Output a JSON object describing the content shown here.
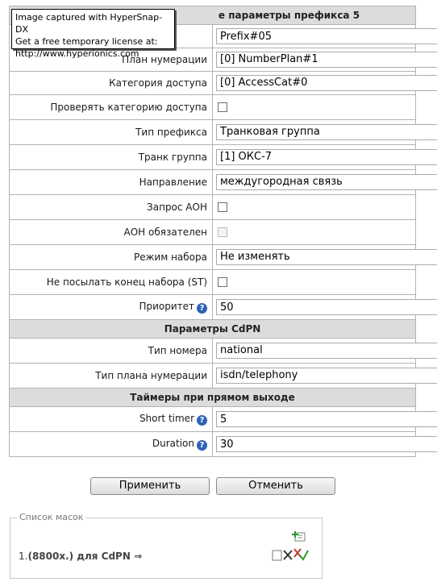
{
  "overlay": {
    "line1": "Image captured with HyperSnap-DX",
    "line2": "Get a free temporary license at:",
    "line3": "http://www.hyperionics.com"
  },
  "prefix_section": {
    "header": "е параметры префикса 5",
    "name_value": "Prefix#05",
    "fields": {
      "numplan_label": "План нумерации",
      "numplan_value": "[0] NumberPlan#1",
      "access_label": "Категория доступа",
      "access_value": "[0] AccessCat#0",
      "check_access_label": "Проверять категорию доступа",
      "prefix_type_label": "Тип префикса",
      "prefix_type_value": "Транковая группа",
      "trunk_label": "Транк группа",
      "trunk_value": "[1] ОКС-7",
      "direction_label": "Направление",
      "direction_value": "междугородная связь",
      "aon_request_label": "Запрос АОН",
      "aon_required_label": "АОН обязателен",
      "dial_mode_label": "Режим набора",
      "dial_mode_value": "Не изменять",
      "no_st_label": "Не посылать конец набора (ST)",
      "priority_label": "Приоритет",
      "priority_value": "50"
    }
  },
  "cdpn_section": {
    "header": "Параметры CdPN",
    "number_type_label": "Тип номера",
    "number_type_value": "national",
    "plan_type_label": "Тип плана нумерации",
    "plan_type_value": "isdn/telephony"
  },
  "timers_section": {
    "header": "Таймеры при прямом выходе",
    "short_timer_label": "Short timer",
    "short_timer_value": "5",
    "duration_label": "Duration",
    "duration_value": "30"
  },
  "buttons": {
    "apply": "Применить",
    "cancel": "Отменить"
  },
  "masks": {
    "legend": "Список масок",
    "items": [
      {
        "index": "1.",
        "mask": "(8800x.) для CdPN ⇒"
      }
    ]
  },
  "icons": {
    "help": "help-icon",
    "add": "add-mask-icon",
    "tools": "edit-tools-icon"
  },
  "colors": {
    "header_bg": "#dcdcdc",
    "border": "#b3b3b3",
    "help_blue": "#2d62b8"
  }
}
